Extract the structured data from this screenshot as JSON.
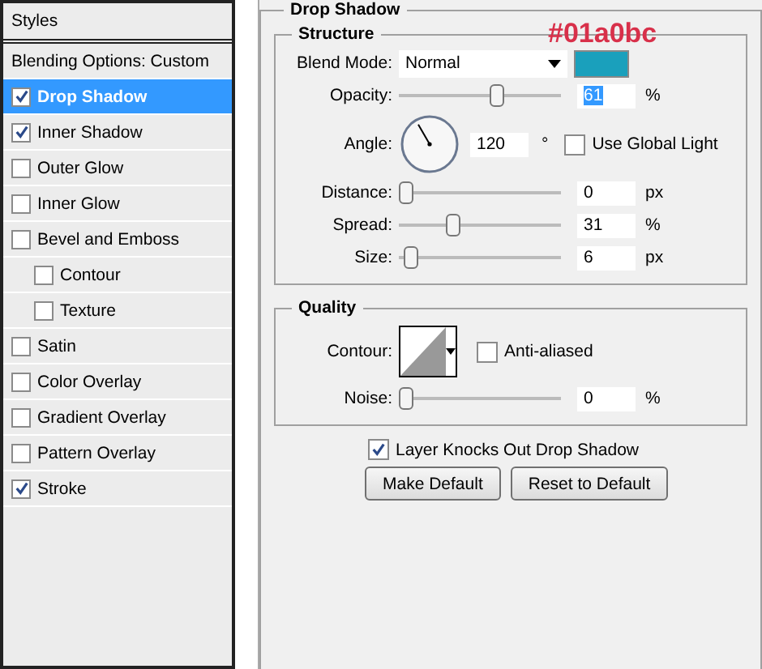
{
  "styles_panel": {
    "title": "Styles",
    "blending_options": "Blending Options: Custom",
    "items": [
      {
        "label": "Drop Shadow",
        "checked": true,
        "selected": true
      },
      {
        "label": "Inner Shadow",
        "checked": true,
        "selected": false
      },
      {
        "label": "Outer Glow",
        "checked": false,
        "selected": false
      },
      {
        "label": "Inner Glow",
        "checked": false,
        "selected": false
      },
      {
        "label": "Bevel and Emboss",
        "checked": false,
        "selected": false,
        "children": [
          {
            "label": "Contour",
            "checked": false,
            "selected": false
          },
          {
            "label": "Texture",
            "checked": false,
            "selected": false
          }
        ]
      },
      {
        "label": "Satin",
        "checked": false,
        "selected": false
      },
      {
        "label": "Color Overlay",
        "checked": false,
        "selected": false
      },
      {
        "label": "Gradient Overlay",
        "checked": false,
        "selected": false
      },
      {
        "label": "Pattern Overlay",
        "checked": false,
        "selected": false
      },
      {
        "label": "Stroke",
        "checked": true,
        "selected": false
      }
    ]
  },
  "drop_shadow": {
    "title": "Drop Shadow",
    "annotation": "#01a0bc",
    "structure": {
      "title": "Structure",
      "blend_mode": {
        "label": "Blend Mode:",
        "value": "Normal",
        "color": "#1aa0bc"
      },
      "opacity": {
        "label": "Opacity:",
        "level": 0.61,
        "value": "61",
        "unit": "%"
      },
      "angle": {
        "label": "Angle:",
        "value": "120",
        "unit": "°",
        "global_light": {
          "label": "Use Global Light",
          "checked": false
        }
      },
      "sliders": [
        {
          "label": "Distance:",
          "level": 0,
          "value": "0",
          "unit": "px"
        },
        {
          "label": "Spread:",
          "level": 0.31,
          "value": "31",
          "unit": "%"
        },
        {
          "label": "Size:",
          "level": 0.03,
          "value": "6",
          "unit": "px"
        }
      ]
    },
    "quality": {
      "title": "Quality",
      "contour": {
        "label": "Contour:",
        "anti_aliased": {
          "label": "Anti-aliased",
          "checked": false
        }
      },
      "noise": {
        "label": "Noise:",
        "level": 0,
        "value": "0",
        "unit": "%"
      }
    },
    "knockout": {
      "label": "Layer Knocks Out Drop Shadow",
      "checked": true
    },
    "buttons": [
      "Make Default",
      "Reset to Default"
    ]
  }
}
